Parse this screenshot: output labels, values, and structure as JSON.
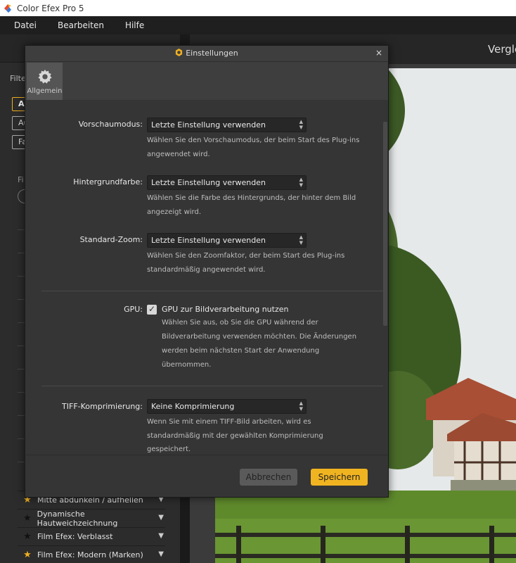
{
  "window": {
    "title": "Color Efex Pro 5"
  },
  "menubar": {
    "items": [
      "Datei",
      "Bearbeiten",
      "Hilfe"
    ]
  },
  "left_panel": {
    "filter_label": "Filte",
    "buttons": [
      "Al",
      "Au",
      "Fa"
    ],
    "list_label": "Fi",
    "filters": [
      {
        "name": "Mitte abdunkeln / aufhellen",
        "starred": true
      },
      {
        "name": "Dynamische Hautweichzeichnung",
        "starred": false
      },
      {
        "name": "Film Efex: Verblasst",
        "starred": false
      },
      {
        "name": "Film Efex: Modern (Marken)",
        "starred": true
      }
    ]
  },
  "right_panel": {
    "compare_label": "Vergle"
  },
  "dialog": {
    "title": "Einstellungen",
    "close_icon": "×",
    "tab_general": "Allgemein",
    "settings": {
      "preview_mode": {
        "label": "Vorschaumodus:",
        "value": "Letzte Einstellung verwenden",
        "desc_line1": "Wählen Sie den Vorschaumodus, der beim Start des Plug-ins",
        "desc_line2": "angewendet wird."
      },
      "background_color": {
        "label": "Hintergrundfarbe:",
        "value": "Letzte Einstellung verwenden",
        "desc_line1": "Wählen Sie die Farbe des Hintergrunds, der hinter dem Bild",
        "desc_line2": "angezeigt wird."
      },
      "default_zoom": {
        "label": "Standard-Zoom:",
        "value": "Letzte Einstellung verwenden",
        "desc_line1": "Wählen Sie den Zoomfaktor, der beim Start des Plug-ins",
        "desc_line2": "standardmäßig angewendet wird."
      },
      "gpu": {
        "label": "GPU:",
        "checkbox_label": "GPU zur Bildverarbeitung nutzen",
        "checked": true,
        "desc_line1": "Wählen Sie aus, ob Sie die GPU während der",
        "desc_line2": "Bildverarbeitung verwenden möchten. Die Änderungen",
        "desc_line3": "werden beim nächsten Start der Anwendung",
        "desc_line4": "übernommen."
      },
      "tiff": {
        "label": "TIFF-Komprimierung:",
        "value": "Keine Komprimierung",
        "desc_line1": "Wenn Sie mit einem TIFF-Bild arbeiten, wird es",
        "desc_line2": "standardmäßig mit der gewählten Komprimierung",
        "desc_line3": "gespeichert."
      }
    },
    "buttons": {
      "cancel": "Abbrechen",
      "save": "Speichern"
    }
  },
  "colors": {
    "accent": "#f1b421",
    "dialog_bg": "#353535",
    "app_bg": "#2c2c2c"
  }
}
